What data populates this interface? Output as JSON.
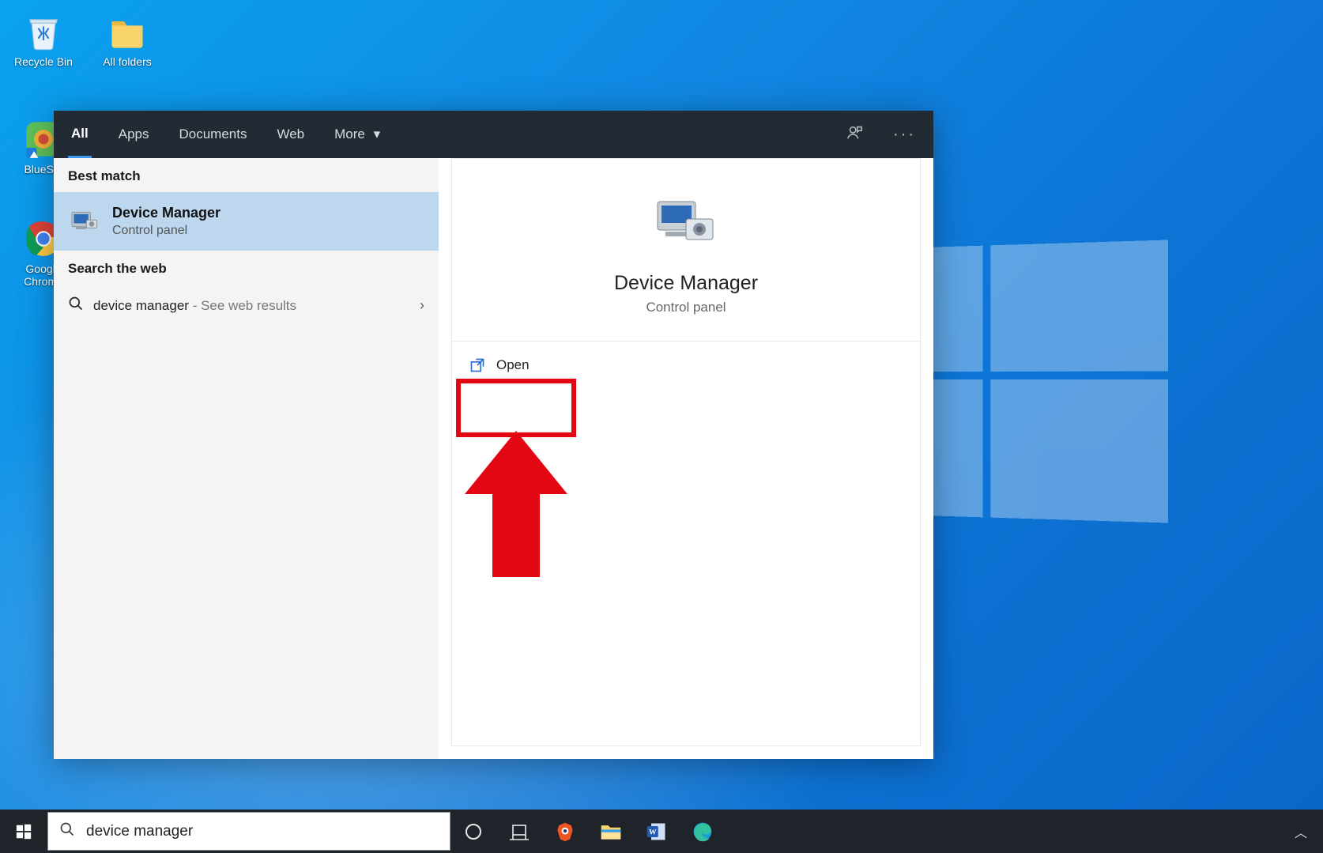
{
  "desktop": {
    "icons": [
      {
        "label": "Recycle Bin"
      },
      {
        "label": "All folders"
      },
      {
        "label": "BlueSta"
      },
      {
        "label": "Google Chrome"
      }
    ]
  },
  "search_panel": {
    "tabs": [
      "All",
      "Apps",
      "Documents",
      "Web",
      "More"
    ],
    "active_tab": "All",
    "sections": {
      "best_match_header": "Best match",
      "best_match": {
        "title": "Device Manager",
        "subtitle": "Control panel"
      },
      "web_header": "Search the web",
      "web_item": {
        "query": "device manager",
        "hint": " - See web results"
      }
    },
    "preview": {
      "title": "Device Manager",
      "subtitle": "Control panel",
      "actions": {
        "open": "Open"
      }
    }
  },
  "taskbar": {
    "search_value": "device manager"
  },
  "annotation": {
    "highlight_target": "open-action"
  }
}
